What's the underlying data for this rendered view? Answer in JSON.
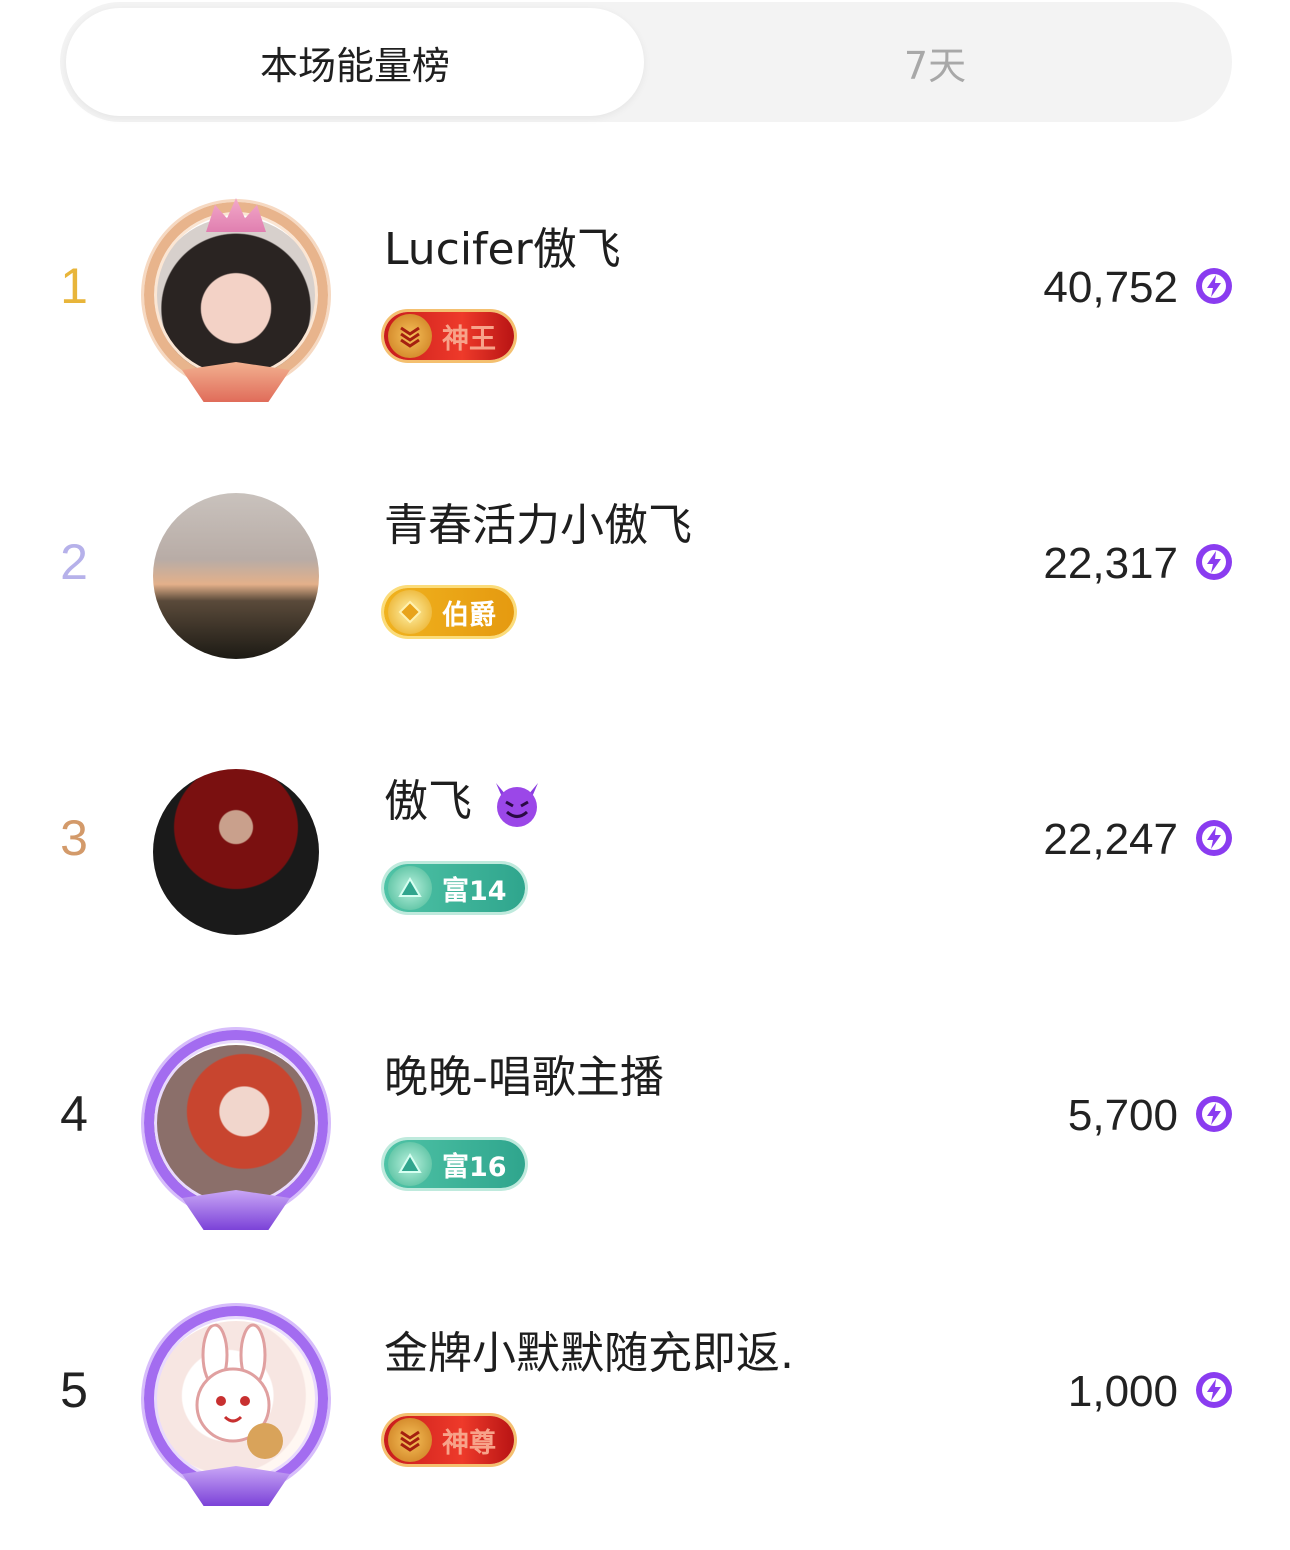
{
  "tabs": [
    {
      "label": "本场能量榜",
      "active": true
    },
    {
      "label": "7天",
      "active": false
    }
  ],
  "ranking": [
    {
      "rank": "1",
      "rank_color": "#e8b53a",
      "name": "Lucifer傲飞",
      "badge": "神王",
      "badge_style": "red",
      "value": "40,752",
      "avatar_icon": "woman-portrait-avatar",
      "frame": "gold-crown-frame"
    },
    {
      "rank": "2",
      "rank_color": "#b6b1ea",
      "name": "青春活力小傲飞",
      "badge": "伯爵",
      "badge_style": "gold",
      "value": "22,317",
      "avatar_icon": "sunset-landscape-avatar",
      "frame": "none"
    },
    {
      "rank": "3",
      "rank_color": "#d39a6a",
      "name": "傲飞",
      "name_emoji": "smiling-devil-emoji",
      "badge": "富14",
      "badge_style": "teal",
      "value": "22,247",
      "avatar_icon": "lucifer-poster-avatar",
      "frame": "none"
    },
    {
      "rank": "4",
      "rank_color": "#222222",
      "name": "晚晚-唱歌主播",
      "badge": "富16",
      "badge_style": "teal",
      "value": "5,700",
      "avatar_icon": "red-hair-woman-avatar",
      "frame": "purple-frame"
    },
    {
      "rank": "5",
      "rank_color": "#222222",
      "name": "金牌小默默随充即返.",
      "badge": "神尊",
      "badge_style": "red",
      "value": "1,000",
      "avatar_icon": "rabbit-cartoon-avatar",
      "frame": "purple-frame"
    }
  ],
  "value_icon": "purple-lightning-icon",
  "colors": {
    "energy": "#8a3cf0",
    "tab_bg": "#f3f3f3"
  }
}
